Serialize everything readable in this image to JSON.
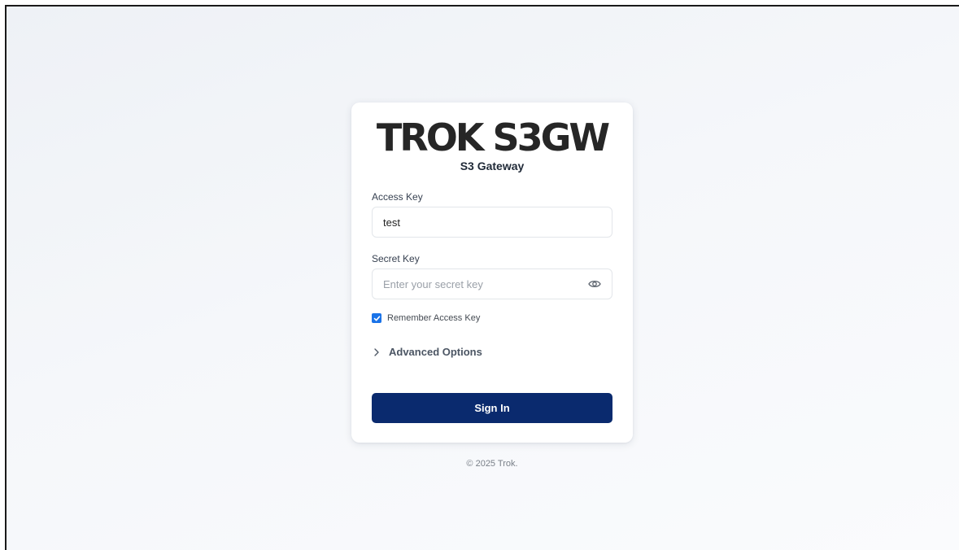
{
  "brand": {
    "logo_text": "TROK S3GW",
    "subtitle": "S3 Gateway"
  },
  "form": {
    "access_key_label": "Access Key",
    "access_key_value": "test",
    "secret_key_label": "Secret Key",
    "secret_key_placeholder": "Enter your secret key",
    "remember_label": "Remember Access Key",
    "remember_checked": true,
    "advanced_label": "Advanced Options",
    "signin_label": "Sign In"
  },
  "footer": {
    "copyright": "© 2025 Trok."
  },
  "colors": {
    "primary_button": "#0a2a6e",
    "checkbox": "#1a73e8",
    "logo": "#262626"
  },
  "icons": {
    "password_toggle": "eye-icon",
    "advanced_toggle": "chevron-right-icon",
    "checkbox_mark": "check-icon"
  }
}
